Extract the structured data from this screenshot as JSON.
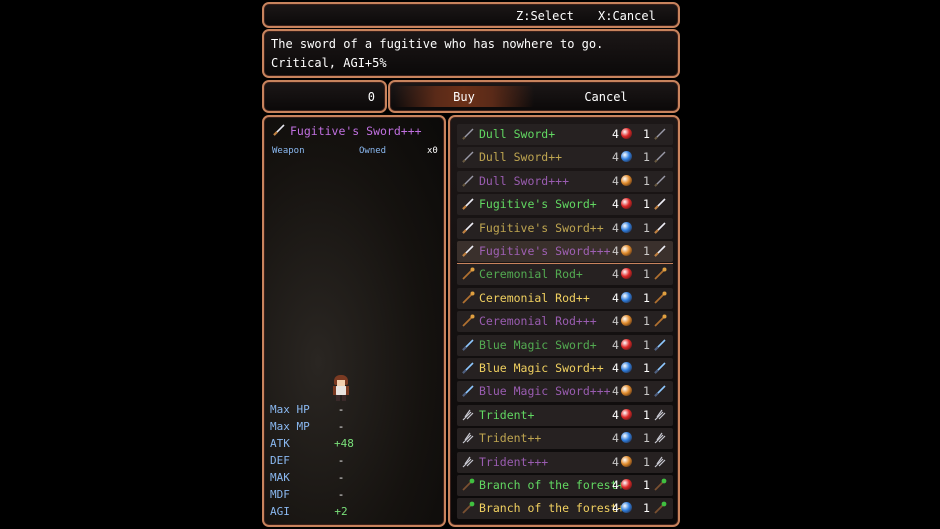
{
  "help": {
    "select": "Z:Select",
    "cancel": "X:Cancel"
  },
  "description": {
    "line1": "The sword of a fugitive who has nowhere to go.",
    "line2": "Critical, AGI+5%"
  },
  "number": "0",
  "commands": {
    "buy": "Buy",
    "cancel": "Cancel"
  },
  "status": {
    "item_name": "Fugitive's Sword+++",
    "type_label": "Weapon",
    "owned_label": "Owned",
    "owned_count": "x0",
    "stats": [
      {
        "label": "Max HP",
        "value": "-"
      },
      {
        "label": "Max MP",
        "value": "-"
      },
      {
        "label": "ATK",
        "value": "+48"
      },
      {
        "label": "DEF",
        "value": "-"
      },
      {
        "label": "MAK",
        "value": "-"
      },
      {
        "label": "MDF",
        "value": "-"
      },
      {
        "label": "AGI",
        "value": "+2"
      }
    ]
  },
  "items": [
    {
      "name": "Dull Sword+",
      "count": "4",
      "qty": "1",
      "orb": "red",
      "tier": "g",
      "icon": "sword",
      "dim": false
    },
    {
      "name": "Dull Sword++",
      "count": "4",
      "qty": "1",
      "orb": "blue",
      "tier": "y",
      "icon": "sword",
      "dim": true
    },
    {
      "name": "Dull Sword+++",
      "count": "4",
      "qty": "1",
      "orb": "orange",
      "tier": "p",
      "icon": "sword",
      "dim": true
    },
    {
      "name": "Fugitive's Sword+",
      "count": "4",
      "qty": "1",
      "orb": "red",
      "tier": "g",
      "icon": "sword-bright",
      "dim": false
    },
    {
      "name": "Fugitive's Sword++",
      "count": "4",
      "qty": "1",
      "orb": "blue",
      "tier": "y",
      "icon": "sword-bright",
      "dim": true
    },
    {
      "name": "Fugitive's Sword+++",
      "count": "4",
      "qty": "1",
      "orb": "orange",
      "tier": "p",
      "icon": "sword-bright",
      "dim": true
    },
    {
      "name": "Ceremonial Rod+",
      "count": "4",
      "qty": "1",
      "orb": "red",
      "tier": "g",
      "icon": "rod",
      "dim": true
    },
    {
      "name": "Ceremonial Rod++",
      "count": "4",
      "qty": "1",
      "orb": "blue",
      "tier": "y",
      "icon": "rod",
      "dim": false
    },
    {
      "name": "Ceremonial Rod+++",
      "count": "4",
      "qty": "1",
      "orb": "orange",
      "tier": "p",
      "icon": "rod",
      "dim": true
    },
    {
      "name": "Blue Magic Sword+",
      "count": "4",
      "qty": "1",
      "orb": "red",
      "tier": "g",
      "icon": "blue-sword",
      "dim": true
    },
    {
      "name": "Blue Magic Sword++",
      "count": "4",
      "qty": "1",
      "orb": "blue",
      "tier": "y",
      "icon": "blue-sword",
      "dim": false
    },
    {
      "name": "Blue Magic Sword+++",
      "count": "4",
      "qty": "1",
      "orb": "orange",
      "tier": "p",
      "icon": "blue-sword",
      "dim": true
    },
    {
      "name": "Trident+",
      "count": "4",
      "qty": "1",
      "orb": "red",
      "tier": "g",
      "icon": "trident",
      "dim": false
    },
    {
      "name": "Trident++",
      "count": "4",
      "qty": "1",
      "orb": "blue",
      "tier": "y",
      "icon": "trident",
      "dim": true
    },
    {
      "name": "Trident+++",
      "count": "4",
      "qty": "1",
      "orb": "orange",
      "tier": "p",
      "icon": "trident",
      "dim": true
    },
    {
      "name": "Branch of the forest+",
      "count": "4",
      "qty": "1",
      "orb": "red",
      "tier": "g",
      "icon": "branch",
      "dim": false
    },
    {
      "name": "Branch of the forest++",
      "count": "4",
      "qty": "1",
      "orb": "blue",
      "tier": "y",
      "icon": "branch",
      "dim": false
    }
  ],
  "selected_index": 5,
  "colors": {
    "frame": "#c8835d",
    "green": "#62d862",
    "yellow": "#f0d060",
    "purple": "#c070e0",
    "orb_red": "#e02828",
    "orb_blue": "#2f7fe0",
    "orb_orange": "#e08a2a"
  }
}
